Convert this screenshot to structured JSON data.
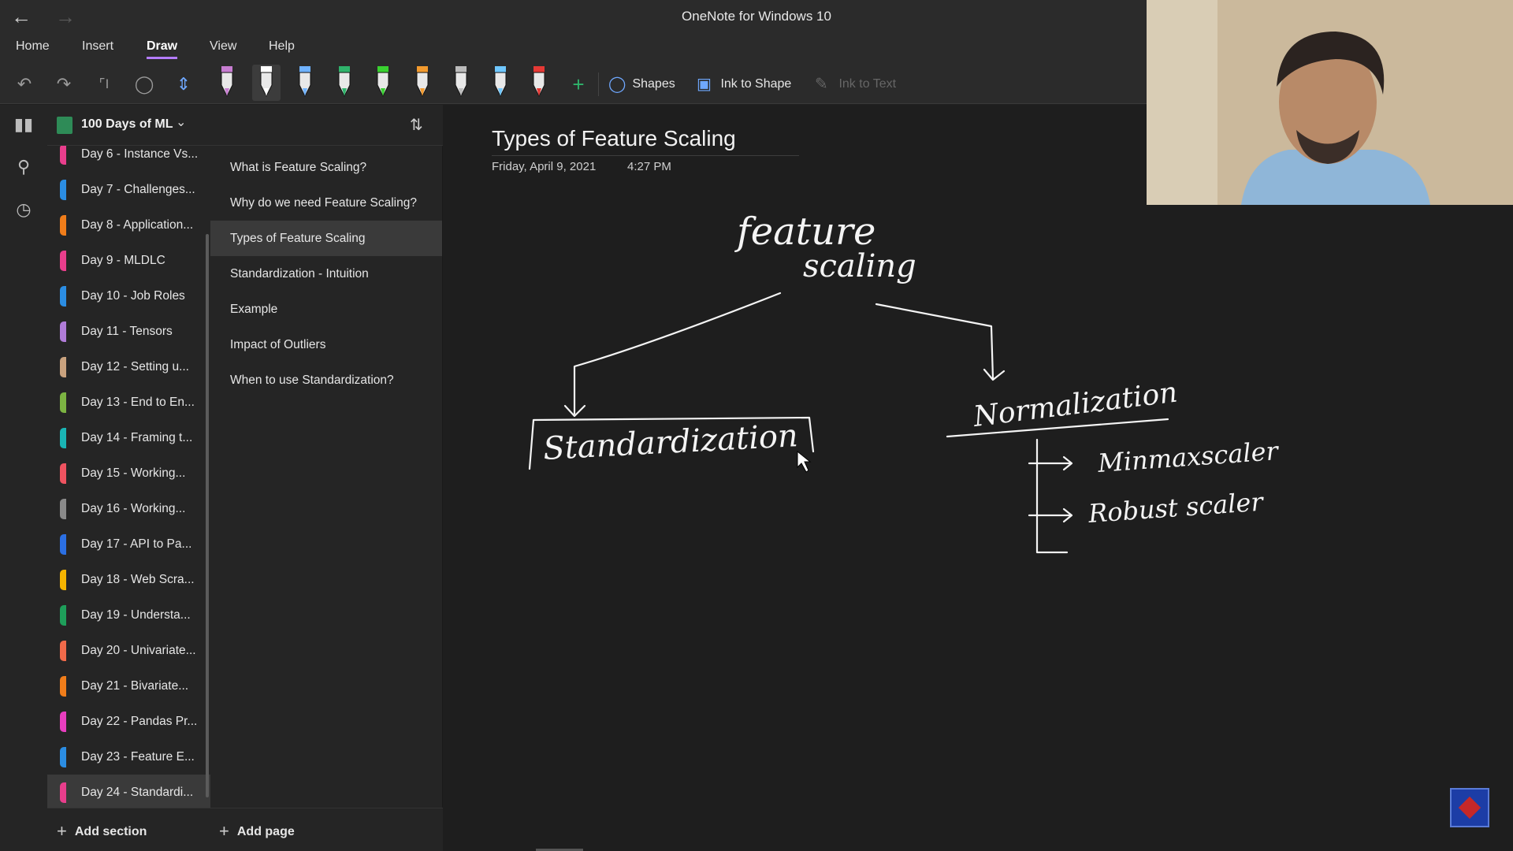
{
  "window": {
    "title": "OneNote for Windows 10"
  },
  "menu": {
    "items": [
      "Home",
      "Insert",
      "Draw",
      "View",
      "Help"
    ],
    "active": "Draw"
  },
  "toolbar": {
    "shapes_label": "Shapes",
    "ink_to_shape_label": "Ink to Shape",
    "ink_to_text_label": "Ink to Text",
    "pens": [
      {
        "name": "highlighter-pen",
        "color": "#c77dd1"
      },
      {
        "name": "pen",
        "color": "#ffffff",
        "selected": true
      },
      {
        "name": "pen",
        "color": "#6fb2ff"
      },
      {
        "name": "pen",
        "color": "#2fb36b"
      },
      {
        "name": "highlighter",
        "color": "#39d130"
      },
      {
        "name": "pen",
        "color": "#f29a2e"
      },
      {
        "name": "pencil",
        "color": "#bbbbbb"
      },
      {
        "name": "pen",
        "color": "#6fc7ff"
      },
      {
        "name": "pen",
        "color": "#e53935"
      }
    ]
  },
  "notebook": {
    "title": "100 Days of ML"
  },
  "sections": [
    {
      "label": "Day 6 - Instance Vs...",
      "color": "#e83e8c"
    },
    {
      "label": "Day 7 - Challenges...",
      "color": "#2b8de3"
    },
    {
      "label": "Day 8 - Application...",
      "color": "#f07d1a"
    },
    {
      "label": "Day 9 - MLDLC",
      "color": "#e83e8c"
    },
    {
      "label": "Day 10 - Job Roles",
      "color": "#2b8de3"
    },
    {
      "label": "Day 11 - Tensors",
      "color": "#b07cd8"
    },
    {
      "label": "Day 12 - Setting u...",
      "color": "#c9a27e"
    },
    {
      "label": "Day 13 - End to En...",
      "color": "#7cb342"
    },
    {
      "label": "Day 14 - Framing t...",
      "color": "#1ab5b5"
    },
    {
      "label": "Day 15 - Working...",
      "color": "#ef5360"
    },
    {
      "label": "Day 16 - Working...",
      "color": "#8a8a8a"
    },
    {
      "label": "Day 17 - API to Pa...",
      "color": "#2b6fe3"
    },
    {
      "label": "Day 18 - Web Scra...",
      "color": "#f5b400"
    },
    {
      "label": "Day 19 - Understa...",
      "color": "#1e9e5a"
    },
    {
      "label": "Day 20 - Univariate...",
      "color": "#f06a4a"
    },
    {
      "label": "Day 21 - Bivariate...",
      "color": "#f07d1a"
    },
    {
      "label": "Day 22 - Pandas Pr...",
      "color": "#e83ebf"
    },
    {
      "label": "Day 23 - Feature E...",
      "color": "#2b8de3"
    },
    {
      "label": "Day 24 - Standardi...",
      "color": "#e83e8c",
      "active": true
    }
  ],
  "pages": [
    {
      "label": "What is Feature Scaling?"
    },
    {
      "label": "Why do we need Feature Scaling?"
    },
    {
      "label": "Types of Feature Scaling",
      "active": true
    },
    {
      "label": "Standardization - Intuition"
    },
    {
      "label": "Example"
    },
    {
      "label": "Impact of Outliers"
    },
    {
      "label": "When to use Standardization?"
    }
  ],
  "add": {
    "section_label": "Add section",
    "page_label": "Add page"
  },
  "page": {
    "title": "Types of Feature Scaling",
    "date": "Friday, April 9, 2021",
    "time": "4:27 PM"
  },
  "ink_text": {
    "root_line1": "feature",
    "root_line2": "scaling",
    "left": "Standardization",
    "right": "Normalization",
    "sub1": "Minmaxscaler",
    "sub2": "Robust scaler"
  }
}
